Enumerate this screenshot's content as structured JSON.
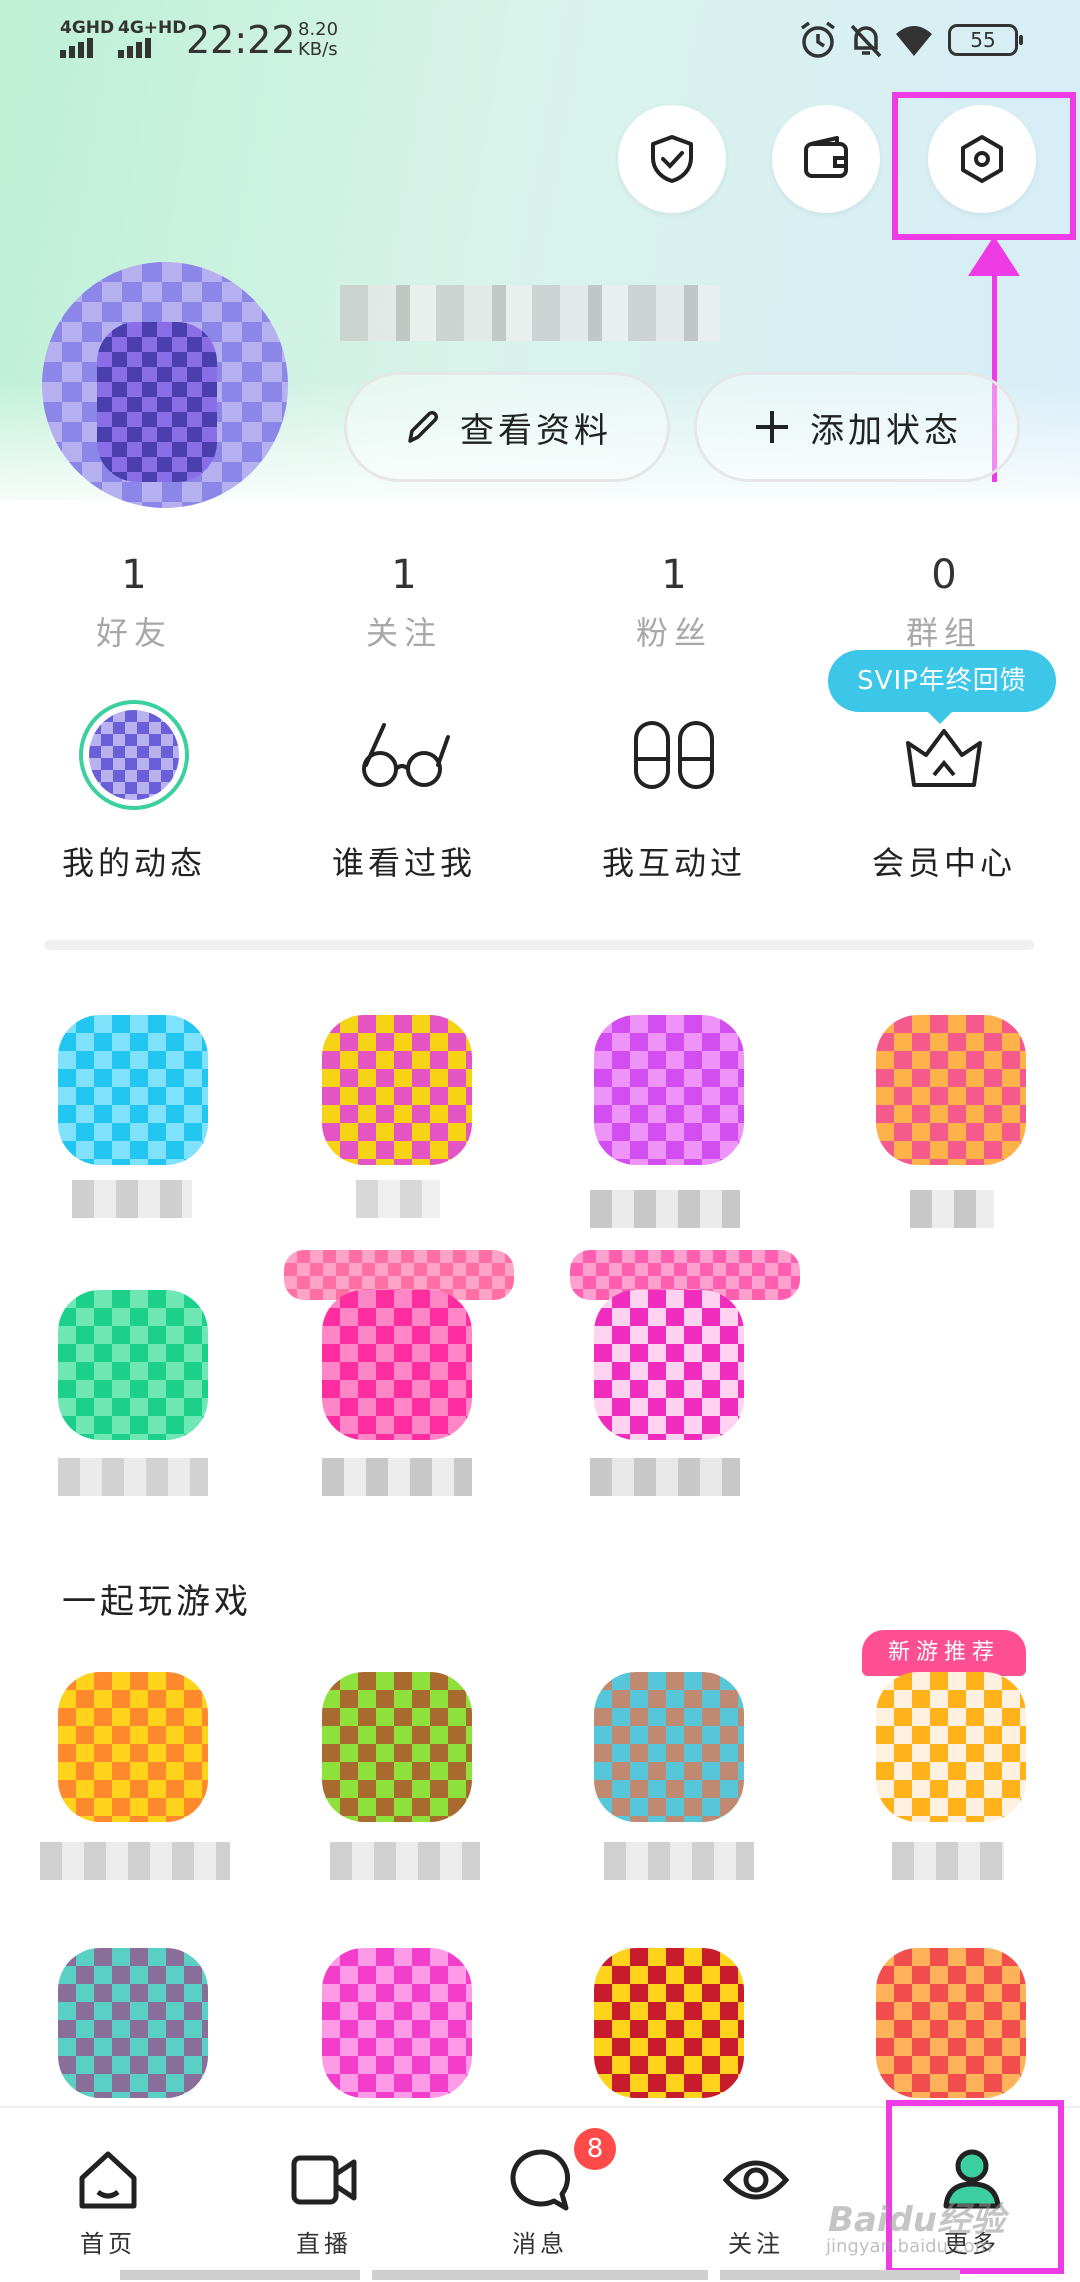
{
  "status_bar": {
    "network1": "4GHD",
    "network2": "4G+HD",
    "time": "22:22",
    "speed_value": "8.20",
    "speed_unit": "KB/s",
    "battery": "55"
  },
  "top_actions": {
    "shield": "shield-check-icon",
    "wallet": "wallet-icon",
    "settings": "settings-hexagon-icon"
  },
  "profile": {
    "view_profile_label": "查看资料",
    "add_status_label": "添加状态"
  },
  "stats": [
    {
      "value": "1",
      "label": "好友"
    },
    {
      "value": "1",
      "label": "关注"
    },
    {
      "value": "1",
      "label": "粉丝"
    },
    {
      "value": "0",
      "label": "群组"
    }
  ],
  "svip_bubble": "SVIP年终回馈",
  "quick_links": [
    {
      "label": "我的动态",
      "icon": "my-feed-avatar-icon"
    },
    {
      "label": "谁看过我",
      "icon": "glasses-icon"
    },
    {
      "label": "我互动过",
      "icon": "footprints-icon"
    },
    {
      "label": "会员中心",
      "icon": "crown-icon"
    }
  ],
  "games_section_title": "一起玩游戏",
  "new_game_badge": "新游推荐",
  "tabbar": [
    {
      "label": "首页",
      "icon": "home-icon"
    },
    {
      "label": "直播",
      "icon": "video-camera-icon"
    },
    {
      "label": "消息",
      "icon": "chat-bubble-icon"
    },
    {
      "label": "关注",
      "icon": "eye-icon"
    },
    {
      "label": "更多",
      "icon": "person-icon"
    }
  ],
  "message_badge": "8",
  "watermark": "Baidu经验",
  "watermark_url": "jingyan.baidu.com",
  "colors": {
    "highlight": "#ef3be6",
    "svip": "#3cc6e8",
    "badge": "#ff4a4a",
    "accent_green": "#3ccf9f"
  }
}
